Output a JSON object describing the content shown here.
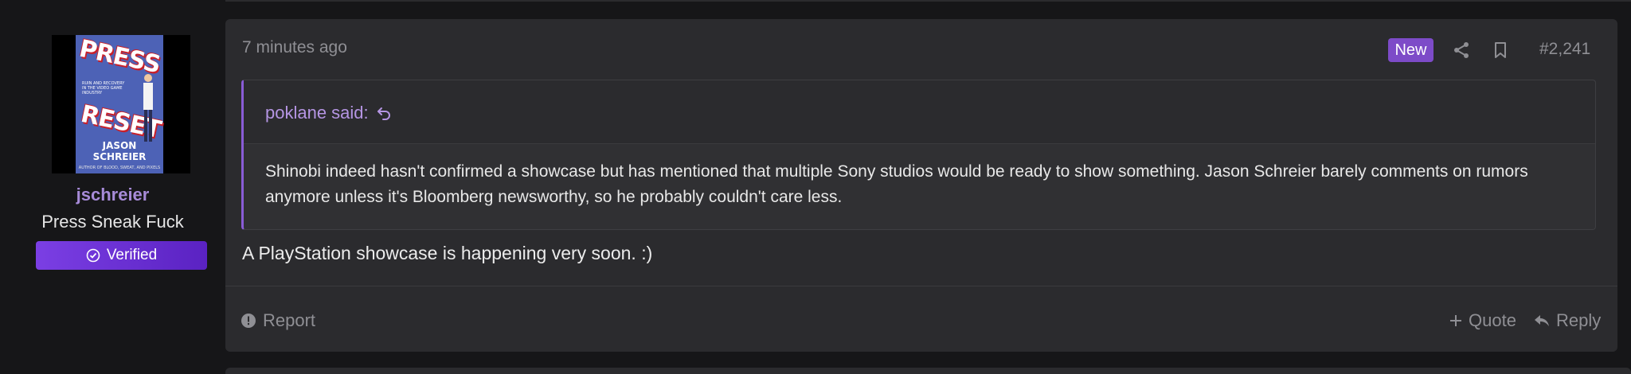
{
  "user": {
    "name": "jschreier",
    "title": "Press Sneak Fuck",
    "badge": "Verified",
    "avatar": {
      "cover_title_1": "PRESS",
      "cover_title_2": "RESET",
      "cover_subtitle": "RUIN AND RECOVERY IN THE VIDEO GAME INDUSTRY",
      "cover_author": "JASON SCHREIER",
      "cover_author_note": "AUTHOR OF BLOOD, SWEAT, AND PIXELS"
    }
  },
  "post": {
    "timestamp": "7 minutes ago",
    "new_badge": "New",
    "number": "#2,241",
    "quote": {
      "author": "poklane said:",
      "body": "Shinobi indeed hasn't confirmed a showcase but has mentioned that multiple Sony studios would be ready to show something. Jason Schreier barely comments on rumors anymore unless it's Bloomberg newsworthy, so he probably couldn't care less."
    },
    "message": "A PlayStation showcase is happening very soon. :)",
    "footer": {
      "report": "Report",
      "quote": "Quote",
      "reply": "Reply"
    }
  },
  "colors": {
    "accent": "#a78bd8",
    "badge_new": "#7d4bc8",
    "verified_start": "#7b3fe4",
    "verified_end": "#5a22c2",
    "panel": "#2b2b2e",
    "background": "#161618"
  }
}
